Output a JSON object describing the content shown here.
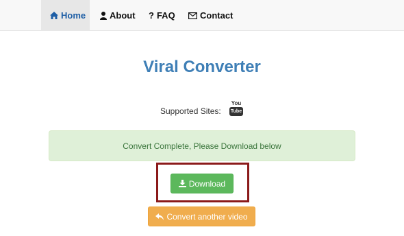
{
  "nav": {
    "items": [
      {
        "label": "Home",
        "icon": "home-icon",
        "active": true
      },
      {
        "label": "About",
        "icon": "user-icon",
        "active": false
      },
      {
        "label": "FAQ",
        "icon": "question-icon",
        "active": false
      },
      {
        "label": "Contact",
        "icon": "envelope-icon",
        "active": false
      }
    ]
  },
  "main": {
    "title": "Viral Converter",
    "supported_label": "Supported Sites:",
    "site_logo": {
      "top": "You",
      "bottom": "Tube",
      "icon": "youtube-logo"
    },
    "alert_text": "Convert Complete, Please Download below",
    "download_label": "Download",
    "convert_another_label": "Convert another video"
  },
  "colors": {
    "title": "#3f7fb6",
    "nav_active": "#1f5fa6",
    "alert_bg": "#dff0d8",
    "download_btn": "#5cb85c",
    "convert_btn": "#f0ad4e",
    "highlight_border": "#8b1a1a"
  }
}
